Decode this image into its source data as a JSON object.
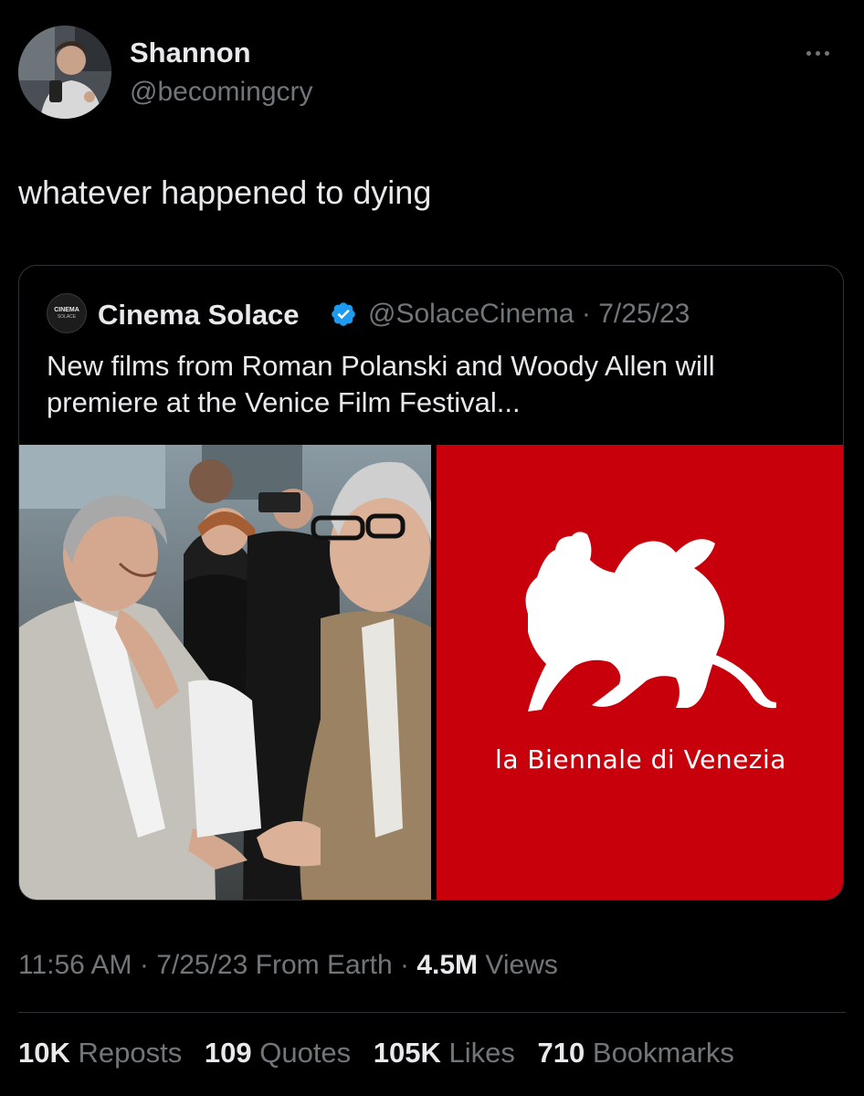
{
  "author": {
    "name": "Shannon",
    "handle": "@becomingcry"
  },
  "tweet": {
    "text": "whatever happened to dying",
    "time": "11:56 AM",
    "date": "7/25/23",
    "source": "From Earth",
    "views_count": "4.5M",
    "views_label": "Views"
  },
  "quoted": {
    "logo_text_top": "CINEMA",
    "logo_text_bottom": "SOLACE",
    "name": "Cinema Solace",
    "handle": "@SolaceCinema",
    "date": "7/25/23",
    "text": "New films from Roman Polanski and Woody Allen will premiere at the Venice Film Festival...",
    "media_right_text": "la Biennale di Venezia"
  },
  "stats": [
    {
      "count": "10K",
      "label": "Reposts"
    },
    {
      "count": "109",
      "label": "Quotes"
    },
    {
      "count": "105K",
      "label": "Likes"
    },
    {
      "count": "710",
      "label": "Bookmarks"
    }
  ],
  "colors": {
    "background": "#000000",
    "text_primary": "#e7e9ea",
    "text_secondary": "#71767b",
    "border": "#2f3336",
    "verified": "#1d9bf0",
    "biennale_red": "#c8000c"
  }
}
